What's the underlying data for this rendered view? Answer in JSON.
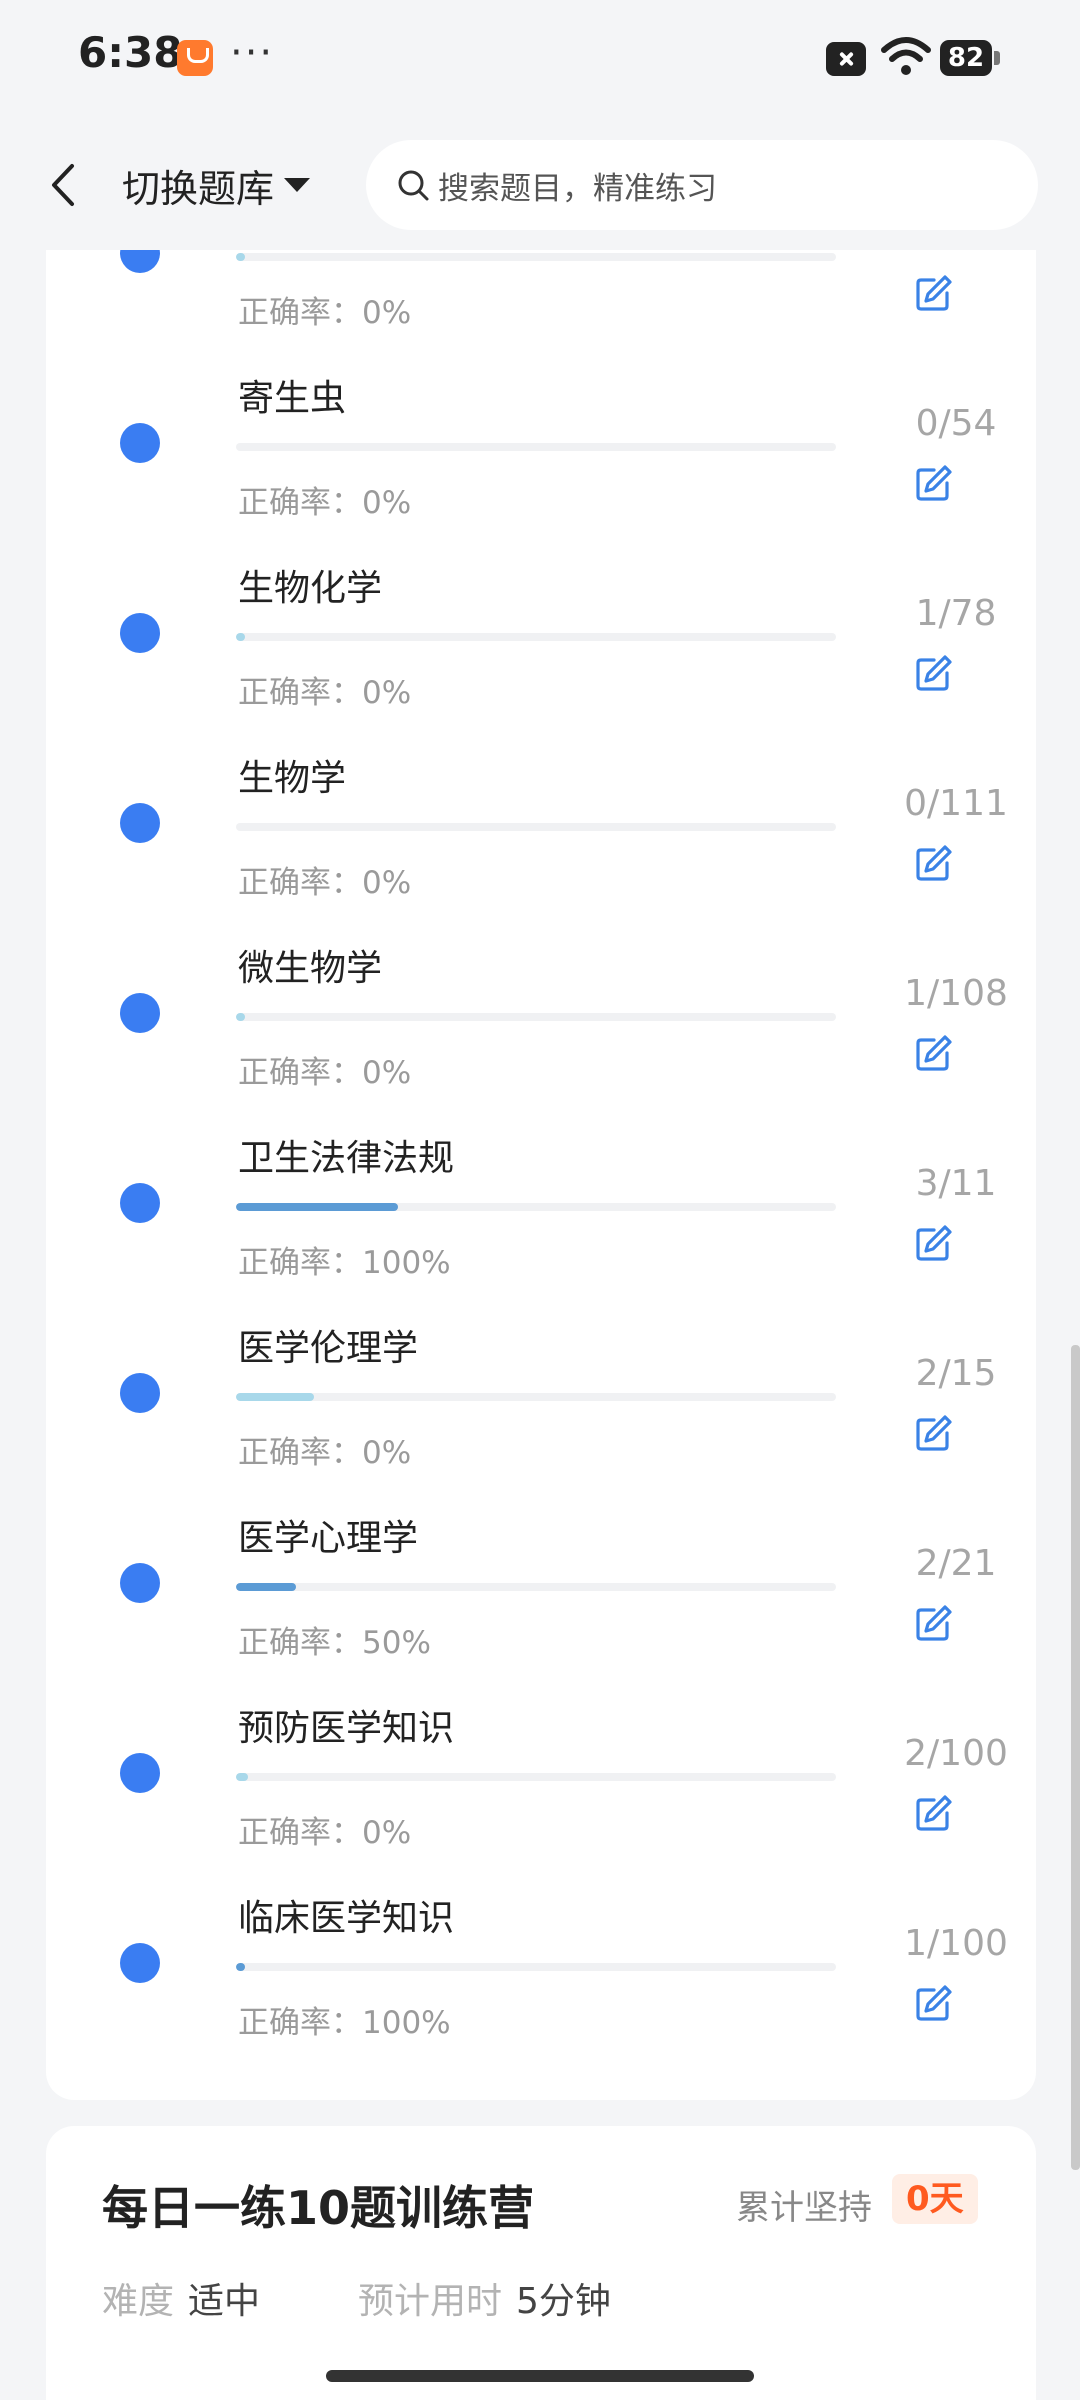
{
  "status_bar": {
    "time": "6:38",
    "more": "···",
    "battery": "82"
  },
  "header": {
    "bank_switch_label": "切换题库",
    "search_placeholder": "搜索题目，精准练习"
  },
  "accuracy_prefix": "正确率：",
  "subjects": [
    {
      "name": "",
      "count": "",
      "accuracy": "0%",
      "progress": 0.015,
      "fill_color": "#a8d8ea"
    },
    {
      "name": "寄生虫",
      "count": "0/54",
      "accuracy": "0%",
      "progress": 0,
      "fill_color": "#a8d8ea"
    },
    {
      "name": "生物化学",
      "count": "1/78",
      "accuracy": "0%",
      "progress": 0.01,
      "fill_color": "#a8d8ea"
    },
    {
      "name": "生物学",
      "count": "0/111",
      "accuracy": "0%",
      "progress": 0,
      "fill_color": "#a8d8ea"
    },
    {
      "name": "微生物学",
      "count": "1/108",
      "accuracy": "0%",
      "progress": 0.01,
      "fill_color": "#a8d8ea"
    },
    {
      "name": "卫生法律法规",
      "count": "3/11",
      "accuracy": "100%",
      "progress": 0.27,
      "fill_color": "#5b9bd5"
    },
    {
      "name": "医学伦理学",
      "count": "2/15",
      "accuracy": "0%",
      "progress": 0.13,
      "fill_color": "#a8d8ea"
    },
    {
      "name": "医学心理学",
      "count": "2/21",
      "accuracy": "50%",
      "progress": 0.1,
      "fill_color": "#5b9bd5"
    },
    {
      "name": "预防医学知识",
      "count": "2/100",
      "accuracy": "0%",
      "progress": 0.02,
      "fill_color": "#a8d8ea"
    },
    {
      "name": "临床医学知识",
      "count": "1/100",
      "accuracy": "100%",
      "progress": 0.01,
      "fill_color": "#5b9bd5"
    }
  ],
  "camp": {
    "title": "每日一练10题训练营",
    "streak_label": "累计坚持",
    "streak_value": "0天",
    "difficulty_label": "难度",
    "difficulty_value": "适中",
    "time_label": "预计用时",
    "time_value": "5分钟"
  },
  "colors": {
    "accent": "#3a7df2",
    "streak": "#ff5a1f",
    "edit_icon": "#3a82e6"
  }
}
